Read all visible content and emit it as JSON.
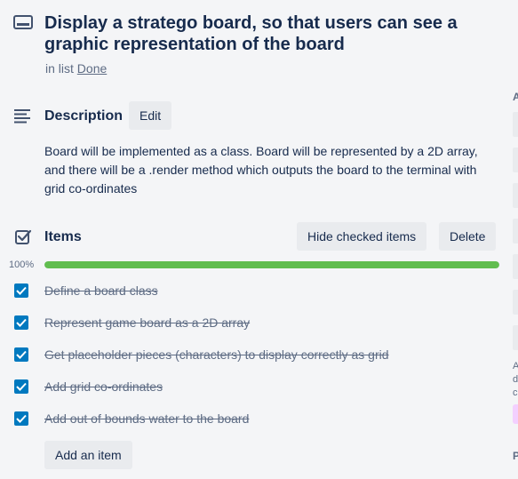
{
  "card": {
    "title": "Display a stratego board, so that users can see a graphic representation of the board",
    "in_list_prefix": "in list",
    "list_name": "Done"
  },
  "description": {
    "heading": "Description",
    "edit_label": "Edit",
    "text": "Board will be implemented as a class. Board will be represented by a 2D array, and there will be a .render method which outputs the board to the terminal with grid co-ordinates"
  },
  "checklist": {
    "heading": "Items",
    "hide_checked_label": "Hide checked items",
    "delete_label": "Delete",
    "progress_label": "100%",
    "progress": 1.0,
    "items": [
      {
        "text": "Define a board class",
        "checked": true
      },
      {
        "text": "Represent game board as a 2D array",
        "checked": true
      },
      {
        "text": "Get placeholder pieces (characters) to display correctly as grid",
        "checked": true
      },
      {
        "text": "Add grid co-ordinates",
        "checked": true
      },
      {
        "text": "Add out of bounds water to the board",
        "checked": true
      }
    ],
    "add_item_label": "Add an item"
  },
  "sidebar_partial": {
    "top_letter": "A",
    "bottom_letter": "P",
    "small_letters": [
      "A",
      "d",
      "c"
    ]
  },
  "colors": {
    "accent": "#0079bf",
    "progress": "#61bd4f",
    "label": "#f3d0ff"
  },
  "icons": {
    "card": "card-icon",
    "description": "description-icon",
    "checklist": "checklist-icon",
    "checkbox": "checkbox-checked-icon"
  }
}
